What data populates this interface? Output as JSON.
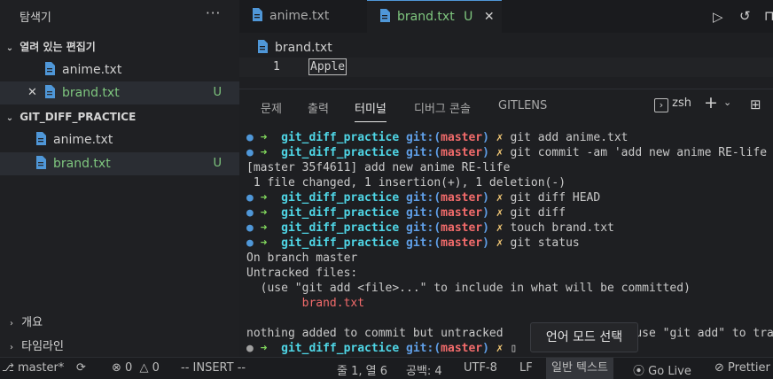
{
  "sidebar": {
    "title": "탐색기",
    "more": "···",
    "open_editors": {
      "label": "열려 있는 편집기",
      "items": [
        {
          "name": "anime.txt",
          "badge": ""
        },
        {
          "name": "brand.txt",
          "badge": "U"
        }
      ]
    },
    "project": {
      "label": "GIT_DIFF_PRACTICE",
      "items": [
        {
          "name": "anime.txt",
          "badge": ""
        },
        {
          "name": "brand.txt",
          "badge": "U"
        }
      ]
    },
    "outline": "개요",
    "timeline": "타임라인"
  },
  "tabs": [
    {
      "label": "anime.txt",
      "badge": ""
    },
    {
      "label": "brand.txt",
      "badge": "U"
    }
  ],
  "editor": {
    "breadcrumb": "brand.txt",
    "line_number": "1",
    "line_text": "Apple"
  },
  "panel": {
    "tabs": [
      "문제",
      "출력",
      "터미널",
      "디버그 콘솔",
      "GITLENS"
    ],
    "active_tab": "터미널",
    "shell": "zsh",
    "add": "+",
    "terminal": {
      "repo": "git_diff_practice",
      "git": "git:(",
      "branch": "master",
      "git_close": ")",
      "x": "✗",
      "commands": [
        "git add anime.txt",
        "git commit -am 'add new anime RE-life",
        "git diff HEAD",
        "git diff",
        "touch brand.txt",
        "git status"
      ],
      "commit_out1": "[master 35f4611] add new anime RE-life",
      "commit_out2": " 1 file changed, 1 insertion(+), 1 deletion(-)",
      "status_out1": "On branch master",
      "status_out2": "Untracked files:",
      "status_out3": "  (use \"git add <file>...\" to include in what will be committed)",
      "status_out4": "        brand.txt",
      "status_out5": "nothing added to commit but untracked",
      "status_out5b": "use \"git add\" to tra"
    }
  },
  "tooltip": "언어 모드 선택",
  "statusbar": {
    "branch": "master*",
    "errors": "0",
    "warnings": "0",
    "mode": "-- INSERT --",
    "position": "줄 1, 열 6",
    "spaces": "공백: 4",
    "encoding": "UTF-8",
    "eol": "LF",
    "language": "일반 텍스트",
    "golive": "Go Live",
    "prettier": "Prettier"
  },
  "colors": {
    "accent": "#4f97d8",
    "untracked": "#7fc77f",
    "branch": "#f26b6b"
  }
}
